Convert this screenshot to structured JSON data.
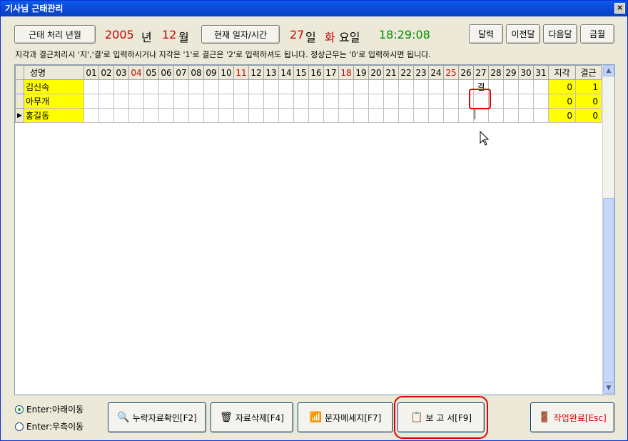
{
  "window": {
    "title": "기사님 근태관리",
    "close": "×"
  },
  "header": {
    "period_button": "근태 처리 년월",
    "year": "2005",
    "year_unit": "년",
    "month": "12",
    "month_unit": "월",
    "current_button": "현재 일자/시간",
    "day": "27",
    "day_unit": "일",
    "weekday": "화",
    "weekday_unit": "요일",
    "time": "18:29:08",
    "calendar_button": "달력",
    "prev_month_button": "이전달",
    "next_month_button": "다음달",
    "this_month_button": "금월"
  },
  "notice": "지각과 결근처리시 '지','결'로 입력하시거나 지각은 '1'로 결근은 '2'로 입력하셔도 됩니다.  정상근무는 '0'로 입력하시면 됩니다.",
  "grid": {
    "name_header": "성명",
    "days": [
      "01",
      "02",
      "03",
      "04",
      "05",
      "06",
      "07",
      "08",
      "09",
      "10",
      "11",
      "12",
      "13",
      "14",
      "15",
      "16",
      "17",
      "18",
      "19",
      "20",
      "21",
      "22",
      "23",
      "24",
      "25",
      "26",
      "27",
      "28",
      "29",
      "30",
      "31"
    ],
    "red_days": [
      "04",
      "11",
      "18",
      "25"
    ],
    "late_header": "지각",
    "absent_header": "결근",
    "rows": [
      {
        "name": "김신속",
        "marks": {
          "27": "결"
        },
        "late": "0",
        "absent": "1"
      },
      {
        "name": "아무개",
        "marks": {},
        "late": "0",
        "absent": "0"
      },
      {
        "name": "홍길동",
        "marks": {},
        "late": "0",
        "absent": "0"
      }
    ]
  },
  "options": {
    "enter_down": "Enter:아래이동",
    "enter_right": "Enter:우측이동"
  },
  "buttons": {
    "missing_check": "누락자료확인[F2]",
    "delete": "자료삭제[F4]",
    "sms": "문자메세지[F7]",
    "report": "보 고 서[F9]",
    "done": "작업완료[Esc]"
  },
  "colors": {
    "accent_red": "#d00000",
    "time_green": "#009000",
    "highlight": "#e00000",
    "cell_yellow": "#ffff00"
  }
}
